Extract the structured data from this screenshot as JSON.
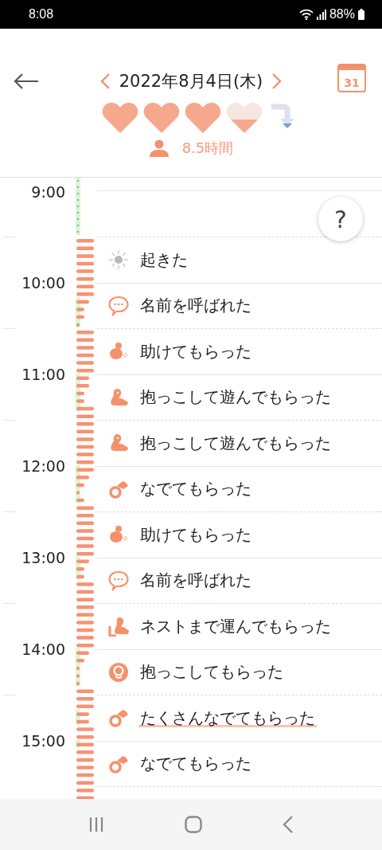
{
  "status_bar": {
    "time": "8:08",
    "battery": "88%"
  },
  "header": {
    "date": "2022年8月4日(木)",
    "calendar_day": "31"
  },
  "hearts": [
    {
      "full": true
    },
    {
      "full": true
    },
    {
      "full": true
    },
    {
      "full": false
    }
  ],
  "sleep": {
    "duration": "8.5時間"
  },
  "help_button": {
    "label": "?"
  },
  "hours": [
    "9:00",
    "10:00",
    "11:00",
    "12:00",
    "13:00",
    "14:00",
    "15:00"
  ],
  "events": [
    {
      "kind": "wake",
      "label": "起きた",
      "highlighted": false
    },
    {
      "kind": "call",
      "label": "名前を呼ばれた",
      "highlighted": false
    },
    {
      "kind": "help",
      "label": "助けてもらった",
      "highlighted": false
    },
    {
      "kind": "hold_play",
      "label": "抱っこして遊んでもらった",
      "highlighted": false
    },
    {
      "kind": "hold_play",
      "label": "抱っこして遊んでもらった",
      "highlighted": false
    },
    {
      "kind": "pet",
      "label": "なでてもらった",
      "highlighted": false
    },
    {
      "kind": "help",
      "label": "助けてもらった",
      "highlighted": false
    },
    {
      "kind": "call",
      "label": "名前を呼ばれた",
      "highlighted": false
    },
    {
      "kind": "nest",
      "label": "ネストまで運んでもらった",
      "highlighted": false
    },
    {
      "kind": "hold",
      "label": "抱っこしてもらった",
      "highlighted": false
    },
    {
      "kind": "pet",
      "label": "たくさんなでてもらった",
      "highlighted": true
    },
    {
      "kind": "pet",
      "label": "なでてもらった",
      "highlighted": false
    }
  ]
}
